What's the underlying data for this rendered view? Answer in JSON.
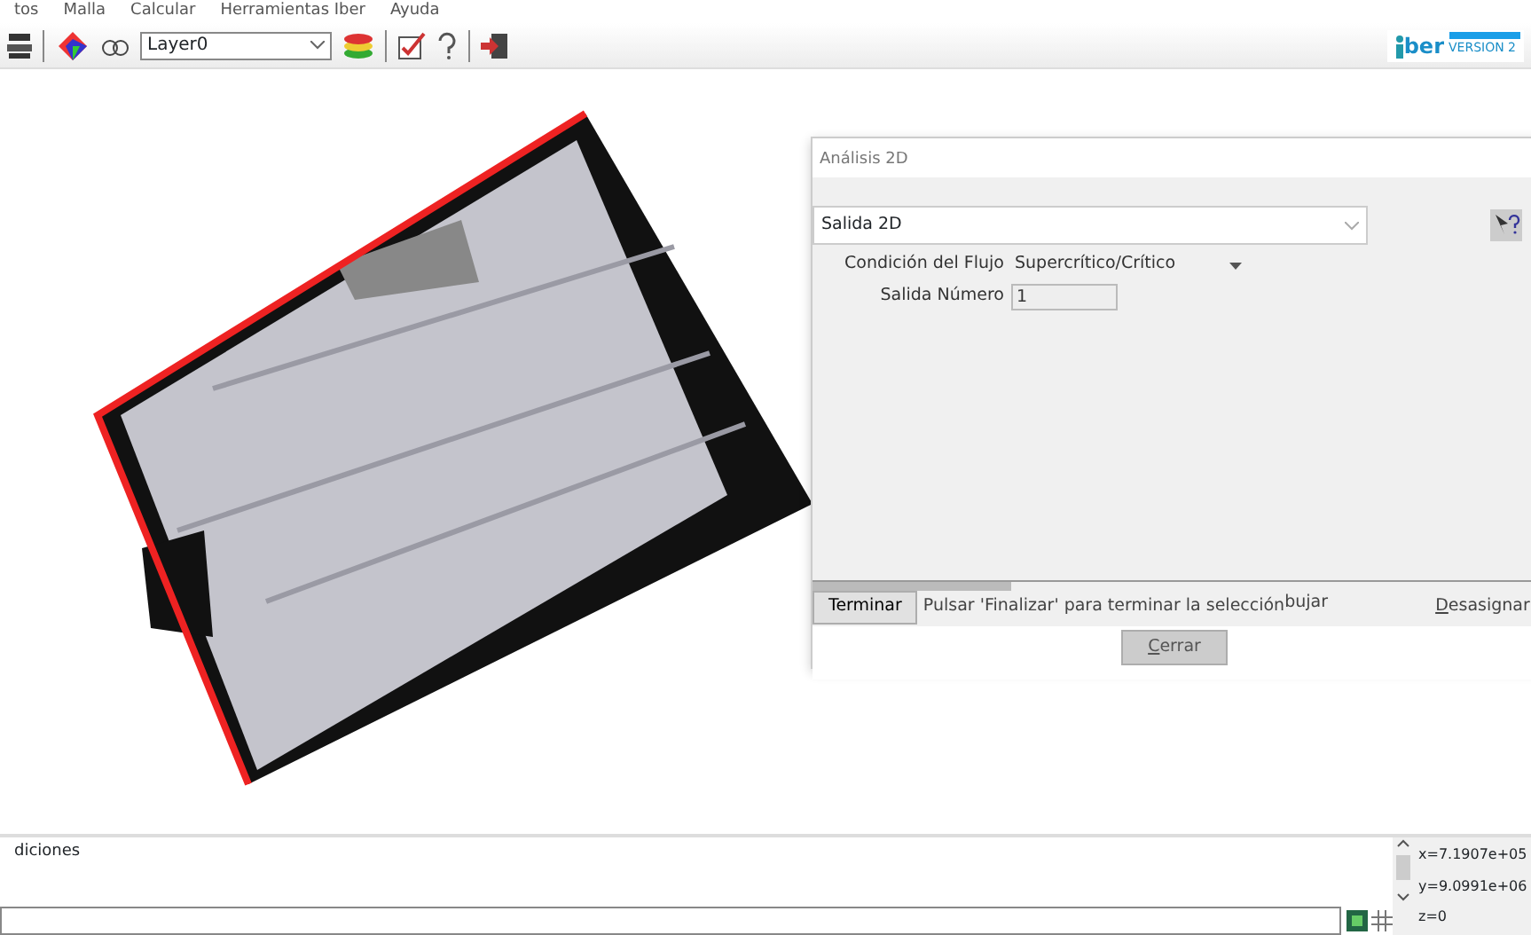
{
  "menu": [
    "tos",
    "Malla",
    "Calcular",
    "Herramientas Iber",
    "Ayuda"
  ],
  "toolbar": {
    "layer": "Layer0"
  },
  "logo": {
    "name": "ber",
    "version": "VERSION 2"
  },
  "dialog": {
    "title": "Análisis 2D",
    "select": "Salida 2D",
    "fields": [
      {
        "kind": "dropdown",
        "label": "Condición del Flujo",
        "value": "Supercrítico/Crítico"
      },
      {
        "kind": "input",
        "label": "Salida Número",
        "value": "1"
      }
    ],
    "terminate_button": "Terminar",
    "hint": "Pulsar 'Finalizar' para terminar la selección",
    "draw_tab": "bujar",
    "unassign_tab": "Desasignar",
    "close_button": "Cerrar"
  },
  "messages": [
    "diciones"
  ],
  "coordinates": [
    "x=7.1907e+05",
    "y=9.0991e+06",
    "z=0"
  ]
}
